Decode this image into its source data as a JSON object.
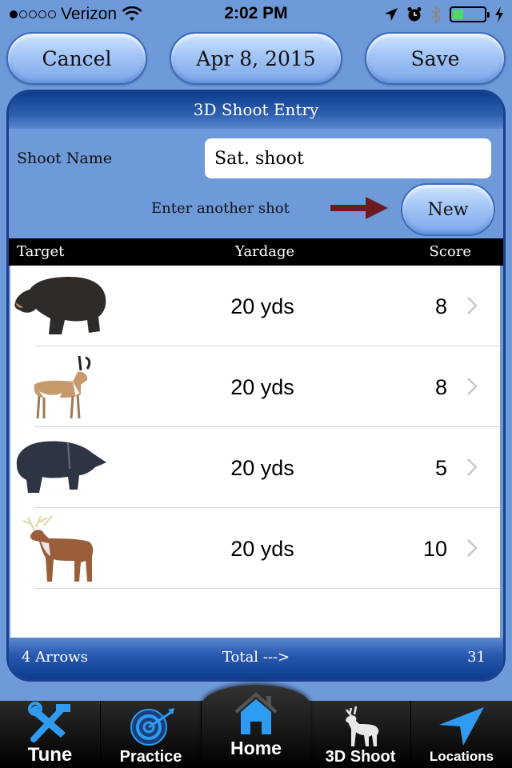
{
  "status_bar": {
    "carrier": "Verizon",
    "signal_bars_filled": 1,
    "signal_bars_total": 5,
    "time": "2:02 PM",
    "battery_level": 0.35,
    "icons": [
      "wifi-icon",
      "location-icon",
      "alarm-icon",
      "bluetooth-icon",
      "battery-icon",
      "charging-icon"
    ]
  },
  "toolbar": {
    "cancel_label": "Cancel",
    "date_label": "Apr 8, 2015",
    "save_label": "Save"
  },
  "panel": {
    "title": "3D Shoot Entry",
    "shoot_name_label": "Shoot Name",
    "shoot_name_value": "Sat. shoot",
    "enter_another_label": "Enter another shot",
    "new_label": "New",
    "arrow_color": "#6b1a1f"
  },
  "table": {
    "headers": {
      "target": "Target",
      "yardage": "Yardage",
      "score": "Score"
    },
    "rows": [
      {
        "target": "bear",
        "yardage": "20 yds",
        "score": "8"
      },
      {
        "target": "pronghorn-antelope",
        "yardage": "20 yds",
        "score": "8"
      },
      {
        "target": "javelina",
        "yardage": "20 yds",
        "score": "5"
      },
      {
        "target": "whitetail-deer",
        "yardage": "20 yds",
        "score": "10"
      }
    ]
  },
  "footer": {
    "arrows": "4 Arrows",
    "total_label": "Total --->",
    "total_value": "31"
  },
  "tabbar": {
    "tabs": [
      {
        "label": "Tune",
        "icon": "tools-icon"
      },
      {
        "label": "Practice",
        "icon": "target-icon"
      },
      {
        "label": "Home",
        "icon": "home-icon",
        "active": true
      },
      {
        "label": "3D Shoot",
        "icon": "deer-icon"
      },
      {
        "label": "Locations",
        "icon": "location-arrow-icon"
      }
    ]
  },
  "colors": {
    "background": "#6e9ad9",
    "panel_header": "#0d3c8c",
    "tab_icon_blue": "#2f9bf0"
  }
}
